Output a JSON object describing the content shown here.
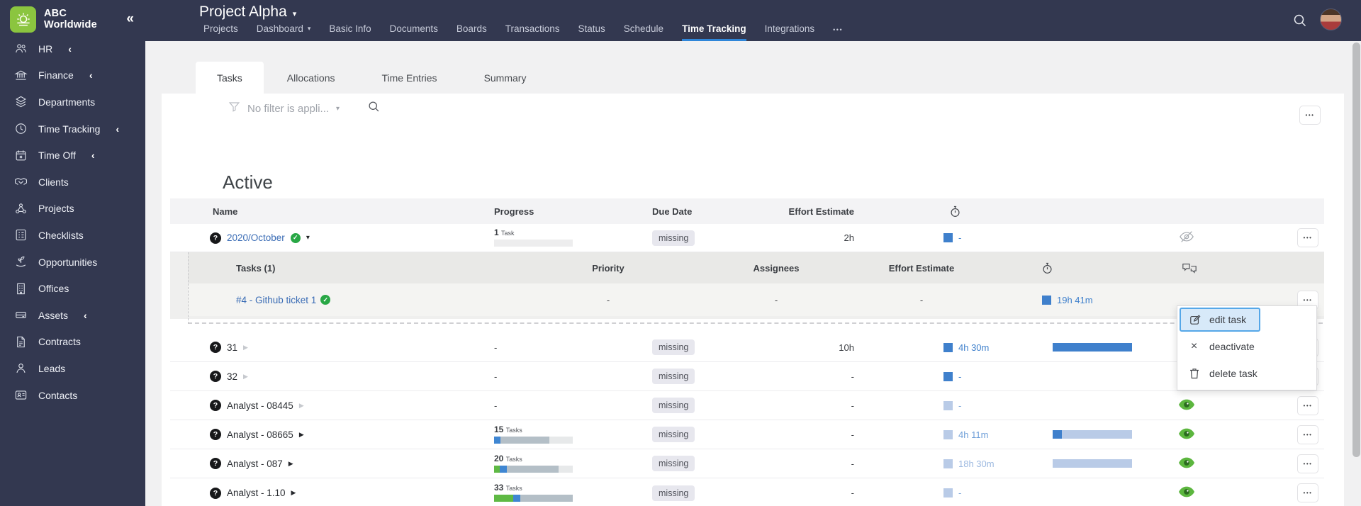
{
  "glyphs": {
    "dots": "•••",
    "caret_down": "▾",
    "expand_arrow": "▶",
    "collapse": "«",
    "chevron": "‹",
    "close": "×",
    "question": "?",
    "check": "✓"
  },
  "colors": {
    "sidebar_bg": "#333850",
    "logo_green": "#8bc53f",
    "accent_blue": "#2f86d9",
    "link_blue": "#3a6cb5",
    "square_blue": "#3f80cc",
    "square_blue_light": "#b9cbe7",
    "bar_green": "#5fb944",
    "bar_blue": "#3f86d2",
    "bar_gray": "#b4bfc7",
    "bar_rest": "#e7e9ea",
    "badge_bg": "#e7e7ee",
    "eye_green": "#5cb63e",
    "menu_highlight_bg": "#d7e9f9",
    "menu_highlight_border": "#55a7e8"
  },
  "sidebar": {
    "company_name": "ABC Worldwide",
    "items": [
      {
        "label": "HR"
      },
      {
        "label": "Finance"
      },
      {
        "label": "Departments"
      },
      {
        "label": "Time Tracking"
      },
      {
        "label": "Time Off"
      },
      {
        "label": "Clients"
      },
      {
        "label": "Projects"
      },
      {
        "label": "Checklists"
      },
      {
        "label": "Opportunities"
      },
      {
        "label": "Offices"
      },
      {
        "label": "Assets"
      },
      {
        "label": "Contracts"
      },
      {
        "label": "Leads"
      },
      {
        "label": "Contacts"
      }
    ]
  },
  "topbar": {
    "project_title": "Project Alpha",
    "tabs": [
      {
        "label": "Projects"
      },
      {
        "label": "Dashboard"
      },
      {
        "label": "Basic Info"
      },
      {
        "label": "Documents"
      },
      {
        "label": "Boards"
      },
      {
        "label": "Transactions"
      },
      {
        "label": "Status"
      },
      {
        "label": "Schedule"
      },
      {
        "label": "Time Tracking"
      },
      {
        "label": "Integrations"
      }
    ],
    "active_tab": "Time Tracking"
  },
  "content": {
    "tabs": [
      {
        "label": "Tasks"
      },
      {
        "label": "Allocations"
      },
      {
        "label": "Time Entries"
      },
      {
        "label": "Summary"
      }
    ],
    "active_tab": "Tasks",
    "filter_text": "No filter is appli...",
    "section_title": "Active"
  },
  "table": {
    "headers": {
      "name": "Name",
      "progress": "Progress",
      "due": "Due Date",
      "effort": "Effort Estimate"
    },
    "rows": [
      {
        "name": "2020/October",
        "progress_count": "1",
        "progress_unit": "Task",
        "due": "missing",
        "effort": "2h",
        "tracked": "-",
        "square": "#3f80cc",
        "tracked_color": "#3f80cc"
      },
      {
        "name": "31",
        "progress": "-",
        "due": "missing",
        "effort": "10h",
        "tracked": "4h 30m",
        "square": "#3f80cc",
        "tracked_color": "#3f80cc",
        "rbar": [
          {
            "w": "100%",
            "color": "#3f80cc"
          }
        ]
      },
      {
        "name": "32",
        "progress": "-",
        "due": "missing",
        "effort": "-",
        "tracked": "-",
        "square": "#3f80cc",
        "tracked_color": "#3f80cc"
      },
      {
        "name": "Analyst - 08445",
        "progress": "-",
        "due": "missing",
        "effort": "-",
        "tracked": "-",
        "square": "#b9cbe7",
        "tracked_color": "#7fa7d9"
      },
      {
        "name": "Analyst - 08665",
        "progress_count": "15",
        "progress_unit": "Tasks",
        "due": "missing",
        "effort": "-",
        "tracked": "4h 11m",
        "square": "#b9cbe7",
        "tracked_color": "#6f9fd8",
        "bar": [
          {
            "w": "8%",
            "color": "#3f86d2"
          },
          {
            "w": "62%",
            "color": "#b4bfc7"
          },
          {
            "w": "30%",
            "color": "#e7e9ea"
          }
        ],
        "rbar": [
          {
            "w": "12%",
            "color": "#3f80cc"
          },
          {
            "w": "88%",
            "color": "#b9cbe7"
          }
        ]
      },
      {
        "name": "Analyst - 087",
        "progress_count": "20",
        "progress_unit": "Tasks",
        "due": "missing",
        "effort": "-",
        "tracked": "18h 30m",
        "square": "#b9cbe7",
        "tracked_color": "#9db9e0",
        "bar": [
          {
            "w": "7%",
            "color": "#5fb944"
          },
          {
            "w": "9%",
            "color": "#3f86d2"
          },
          {
            "w": "66%",
            "color": "#b4bfc7"
          },
          {
            "w": "18%",
            "color": "#e7e9ea"
          }
        ],
        "rbar": [
          {
            "w": "100%",
            "color": "#b9cbe7"
          }
        ]
      },
      {
        "name": "Analyst - 1.10",
        "progress_count": "33",
        "progress_unit": "Tasks",
        "due": "missing",
        "effort": "-",
        "tracked": "-",
        "square": "#b9cbe7",
        "tracked_color": "#7fa7d9",
        "bar": [
          {
            "w": "24%",
            "color": "#5fb944"
          },
          {
            "w": "9%",
            "color": "#3f86d2"
          },
          {
            "w": "67%",
            "color": "#b4bfc7"
          }
        ]
      }
    ]
  },
  "subtable": {
    "title": "Tasks (1)",
    "headers": {
      "priority": "Priority",
      "assignees": "Assignees",
      "effort": "Effort Estimate"
    },
    "row": {
      "name": "#4 - Github ticket 1",
      "priority": "-",
      "assignees": "-",
      "effort": "-",
      "tracked": "19h 41m",
      "square": "#3f80cc",
      "tracked_color": "#3f80cc"
    }
  },
  "menu": {
    "items": [
      {
        "label": "edit task"
      },
      {
        "label": "deactivate"
      },
      {
        "label": "delete task"
      }
    ]
  }
}
